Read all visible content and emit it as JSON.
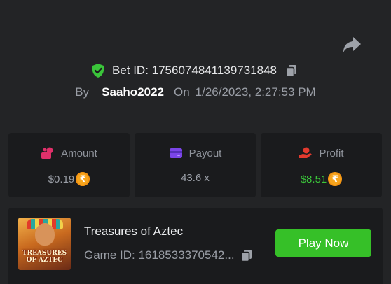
{
  "bet": {
    "id_label": "Bet ID: ",
    "id_value": "1756074841139731848",
    "by_label": "By",
    "username": "Saaho2022",
    "on_label": "On",
    "datetime": "1/26/2023, 2:27:53 PM"
  },
  "stats": {
    "amount": {
      "label": "Amount",
      "value": "$0.19",
      "currency_symbol": "₹",
      "icon": "amount-coins-icon",
      "icon_color": "#e0306a"
    },
    "payout": {
      "label": "Payout",
      "value": "43.6 x",
      "icon": "wallet-icon",
      "icon_color": "#7b45e8"
    },
    "profit": {
      "label": "Profit",
      "value": "$8.51",
      "currency_symbol": "₹",
      "icon": "hand-coin-icon",
      "icon_color": "#e23a2e",
      "value_color": "#3ac53a"
    }
  },
  "game": {
    "thumbnail_text": "TREASURES\nOF AZTEC",
    "name": "Treasures of Aztec",
    "game_id_label": "Game ID: ",
    "game_id_value": "1618533370542...",
    "play_label": "Play Now"
  },
  "colors": {
    "background": "#232426",
    "card": "#1a1b1d",
    "accent_green": "#36c028",
    "verified_green": "#3ac53a",
    "coin": "#f7a51d"
  }
}
